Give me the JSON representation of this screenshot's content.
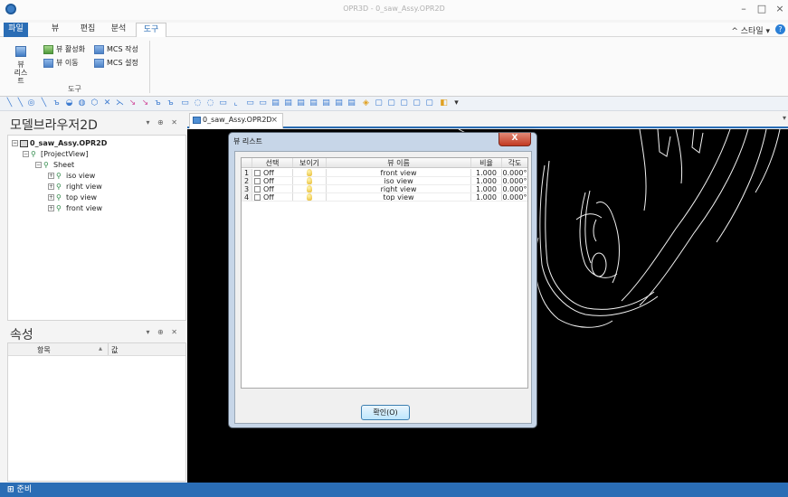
{
  "window": {
    "title": "OPR3D - 0_saw_Assy.OPR2D",
    "minimize": "–",
    "maximize": "□",
    "close": "×"
  },
  "menu": {
    "tabs": [
      "파일",
      "뷰",
      "편집",
      "분석",
      "도구"
    ],
    "active_tab": "도구",
    "style_menu": "^ 스타일 ▾"
  },
  "ribbon": {
    "view_list": "뷰\n리스트",
    "view_list_line1": "뷰",
    "view_list_line2": "리스트",
    "activate_view": "뷰 활성화",
    "move_view": "뷰 이동",
    "create_mcs": "MCS 작성",
    "set_mcs": "MCS 설정",
    "group_label": "도구"
  },
  "model_browser": {
    "title": "모델브라우저2D",
    "controls": "▾ ⊕ ✕",
    "tree": {
      "root": "0_saw_Assy.OPR2D",
      "project_view": "[ProjectView]",
      "sheet": "Sheet",
      "views": [
        "iso view",
        "right view",
        "top view",
        "front view"
      ]
    }
  },
  "properties": {
    "title": "속성",
    "controls": "▾ ⊕ ✕",
    "col_item": "항목",
    "col_value": "값"
  },
  "document": {
    "tab_title": "0_saw_Assy.OPR2D",
    "tab_close": "×"
  },
  "dialog": {
    "title": "뷰 리스트",
    "close_label": "X",
    "columns": [
      "선택",
      "보이기",
      "뷰 이름",
      "비율",
      "각도"
    ],
    "rows": [
      {
        "num": "1",
        "select": "Off",
        "name": "front view",
        "ratio": "1.000",
        "angle": "0.000°"
      },
      {
        "num": "2",
        "select": "Off",
        "name": "iso view",
        "ratio": "1.000",
        "angle": "0.000°"
      },
      {
        "num": "3",
        "select": "Off",
        "name": "right view",
        "ratio": "1.000",
        "angle": "0.000°"
      },
      {
        "num": "4",
        "select": "Off",
        "name": "top view",
        "ratio": "1.000",
        "angle": "0.000°"
      }
    ],
    "ok_button": "확인(O)"
  },
  "status": {
    "text": "준비"
  },
  "colors": {
    "accent": "#2a6db5",
    "canvas": "#000000",
    "dialog_frame": "#c7d6e8"
  }
}
